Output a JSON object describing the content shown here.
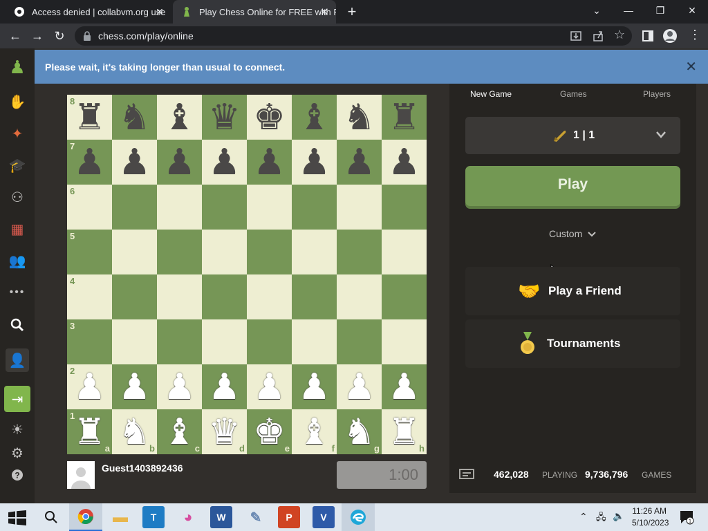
{
  "browser": {
    "tabs": [
      {
        "title": "Access denied | collabvm.org use",
        "active": false
      },
      {
        "title": "Play Chess Online for FREE with F",
        "active": true
      }
    ],
    "url": "chess.com/play/online"
  },
  "notice": {
    "text": "Please wait, it's taking longer than usual to connect."
  },
  "board": {
    "ranks": [
      "8",
      "7",
      "6",
      "5",
      "4",
      "3",
      "2",
      "1"
    ],
    "files": [
      "a",
      "b",
      "c",
      "d",
      "e",
      "f",
      "g",
      "h"
    ],
    "position": [
      [
        "♜",
        "♞",
        "♝",
        "♛",
        "♚",
        "♝",
        "♞",
        "♜"
      ],
      [
        "♟",
        "♟",
        "♟",
        "♟",
        "♟",
        "♟",
        "♟",
        "♟"
      ],
      [
        "",
        "",
        "",
        "",
        "",
        "",
        "",
        ""
      ],
      [
        "",
        "",
        "",
        "",
        "",
        "",
        "",
        ""
      ],
      [
        "",
        "",
        "",
        "",
        "",
        "",
        "",
        ""
      ],
      [
        "",
        "",
        "",
        "",
        "",
        "",
        "",
        ""
      ],
      [
        "♟",
        "♟",
        "♟",
        "♟",
        "♟",
        "♟",
        "♟",
        "♟"
      ],
      [
        "♜",
        "♞",
        "♝",
        "♛",
        "♚",
        "♝",
        "♞",
        "♜"
      ]
    ]
  },
  "player": {
    "name": "Guest1403892436",
    "clock": "1:00"
  },
  "panel": {
    "tabs": [
      "New Game",
      "Games",
      "Players"
    ],
    "time_control": "1 | 1",
    "play_label": "Play",
    "custom_label": "Custom",
    "play_friend_label": "Play a Friend",
    "tournaments_label": "Tournaments"
  },
  "stats": {
    "playing_count": "462,028",
    "playing_label": "PLAYING",
    "games_count": "9,736,796",
    "games_label": "GAMES"
  },
  "taskbar": {
    "time": "11:26 AM",
    "date": "5/10/2023",
    "notifications": "1"
  },
  "colors": {
    "board_light": "#eeeed2",
    "board_dark": "#769656",
    "play_green": "#739853",
    "notice_blue": "#5d8cc0"
  }
}
